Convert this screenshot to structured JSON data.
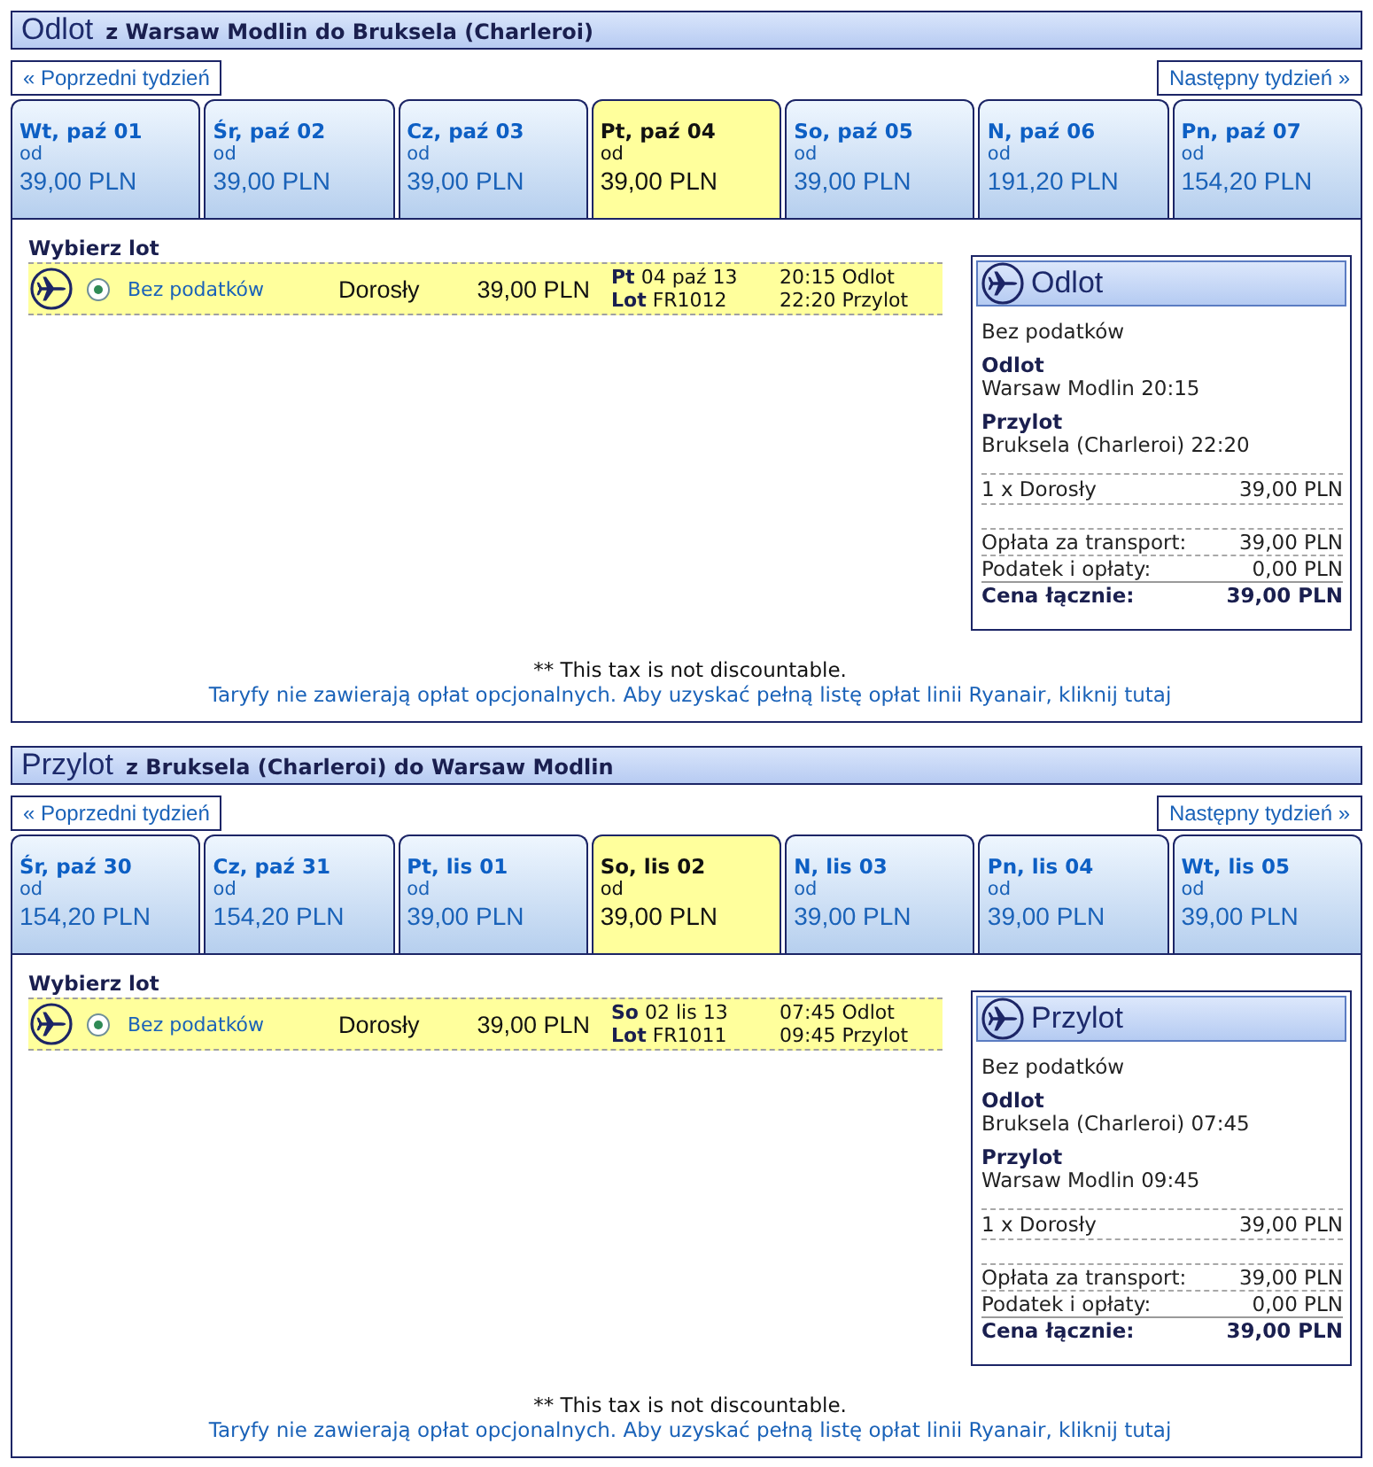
{
  "sections": [
    {
      "title": "Odlot",
      "route": "z Warsaw Modlin do Bruksela (Charleroi)",
      "prev_week": "« Poprzedni tydzień",
      "next_week": "Następny tydzień »",
      "days": [
        {
          "label": "Wt, paź 01",
          "from": "od",
          "price": "39,00 PLN",
          "selected": false
        },
        {
          "label": "Śr, paź 02",
          "from": "od",
          "price": "39,00 PLN",
          "selected": false
        },
        {
          "label": "Cz, paź 03",
          "from": "od",
          "price": "39,00 PLN",
          "selected": false
        },
        {
          "label": "Pt, paź 04",
          "from": "od",
          "price": "39,00 PLN",
          "selected": true
        },
        {
          "label": "So, paź 05",
          "from": "od",
          "price": "39,00 PLN",
          "selected": false
        },
        {
          "label": "N, paź 06",
          "from": "od",
          "price": "191,20 PLN",
          "selected": false
        },
        {
          "label": "Pn, paź 07",
          "from": "od",
          "price": "154,20 PLN",
          "selected": false
        }
      ],
      "choose_label": "Wybierz lot",
      "fares": [
        {
          "name": "Bez podatków",
          "selected": true,
          "passenger": "Dorosły",
          "price": "39,00 PLN",
          "date": "**Pt** 04 paź 13",
          "flight": "**Lot** FR1012",
          "departure": "20:15 Odlot",
          "arrival": "22:20 Przylot"
        }
      ],
      "summary": {
        "title": "Odlot",
        "fare": "Bez podatków",
        "departure_label": "Odlot",
        "departure": "Warsaw Modlin 20:15",
        "arrival_label": "Przylot",
        "arrival": "Bruksela (Charleroi) 22:20",
        "lines": [
          {
            "label": "1 x Dorosły",
            "value": "39,00 PLN"
          }
        ],
        "charges": [
          {
            "label": "Opłata za transport:",
            "value": "39,00 PLN"
          },
          {
            "label": "Podatek i opłaty:",
            "value": "0,00 PLN"
          }
        ],
        "total": {
          "label": "Cena łącznie:",
          "value": "39,00 PLN"
        }
      },
      "note": "** This tax is not discountable.",
      "fees_link": "Taryfy nie zawierają opłat opcjonalnych. Aby uzyskać pełną listę opłat linii Ryanair, kliknij tutaj"
    },
    {
      "title": "Przylot",
      "route": "z Bruksela (Charleroi) do Warsaw Modlin",
      "prev_week": "« Poprzedni tydzień",
      "next_week": "Następny tydzień »",
      "days": [
        {
          "label": "Śr, paź 30",
          "from": "od",
          "price": "154,20 PLN",
          "selected": false
        },
        {
          "label": "Cz, paź 31",
          "from": "od",
          "price": "154,20 PLN",
          "selected": false
        },
        {
          "label": "Pt, lis 01",
          "from": "od",
          "price": "39,00 PLN",
          "selected": false
        },
        {
          "label": "So, lis 02",
          "from": "od",
          "price": "39,00 PLN",
          "selected": true
        },
        {
          "label": "N, lis 03",
          "from": "od",
          "price": "39,00 PLN",
          "selected": false
        },
        {
          "label": "Pn, lis 04",
          "from": "od",
          "price": "39,00 PLN",
          "selected": false
        },
        {
          "label": "Wt, lis 05",
          "from": "od",
          "price": "39,00 PLN",
          "selected": false
        }
      ],
      "choose_label": "Wybierz lot",
      "fares": [
        {
          "name": "Bez podatków",
          "selected": true,
          "passenger": "Dorosły",
          "price": "39,00 PLN",
          "date": "**So** 02 lis 13",
          "flight": "**Lot** FR1011",
          "departure": "07:45 Odlot",
          "arrival": "09:45 Przylot"
        }
      ],
      "summary": {
        "title": "Przylot",
        "fare": "Bez podatków",
        "departure_label": "Odlot",
        "departure": "Bruksela (Charleroi) 07:45",
        "arrival_label": "Przylot",
        "arrival": "Warsaw Modlin 09:45",
        "lines": [
          {
            "label": "1 x Dorosły",
            "value": "39,00 PLN"
          }
        ],
        "charges": [
          {
            "label": "Opłata za transport:",
            "value": "39,00 PLN"
          },
          {
            "label": "Podatek i opłaty:",
            "value": "0,00 PLN"
          }
        ],
        "total": {
          "label": "Cena łącznie:",
          "value": "39,00 PLN"
        }
      },
      "note": "** This tax is not discountable.",
      "fees_link": "Taryfy nie zawierają opłat opcjonalnych. Aby uzyskać pełną listę opłat linii Ryanair, kliknij tutaj"
    }
  ]
}
